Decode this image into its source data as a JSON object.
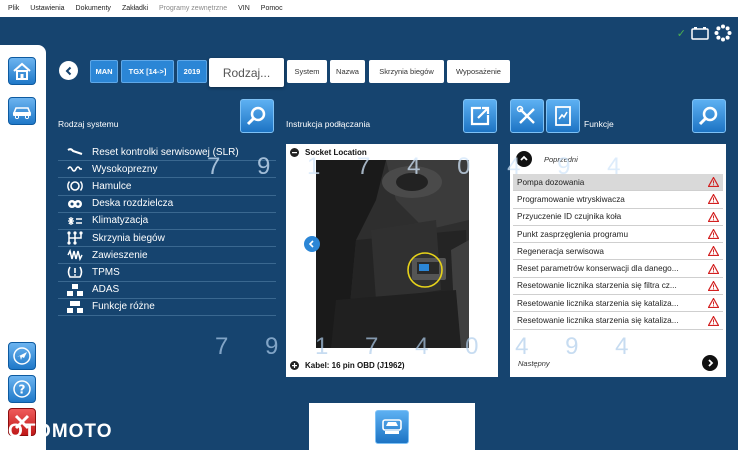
{
  "menu": [
    "Plik",
    "Ustawienia",
    "Dokumenty",
    "Zakładki",
    "Programy zewnętrzne",
    "VIN",
    "Pomoc"
  ],
  "breadcrumb": {
    "make": "MAN",
    "model": "TGX [14->]",
    "year": "2019",
    "active": "Rodzaj...",
    "tabs": [
      "System",
      "Nazwa",
      "Skrzynia biegów",
      "Wyposażenie"
    ]
  },
  "systems": {
    "title": "Rodzaj systemu",
    "items": [
      {
        "label": "Reset kontrolki serwisowej (SLR)",
        "icon": "wrench-icon"
      },
      {
        "label": "Wysokoprezny",
        "icon": "glow-plug-icon"
      },
      {
        "label": "Hamulce",
        "icon": "brake-icon"
      },
      {
        "label": "Deska rozdzielcza",
        "icon": "dashboard-icon"
      },
      {
        "label": "Klimatyzacja",
        "icon": "climate-icon"
      },
      {
        "label": "Skrzynia biegów",
        "icon": "gearbox-icon"
      },
      {
        "label": "Zawieszenie",
        "icon": "suspension-icon"
      },
      {
        "label": "TPMS",
        "icon": "tpms-icon"
      },
      {
        "label": "ADAS",
        "icon": "adas-icon"
      },
      {
        "label": "Funkcje różne",
        "icon": "misc-functions-icon"
      }
    ]
  },
  "instructions": {
    "title": "Instrukcja podłączania",
    "socket_label": "Socket Location",
    "cable_label": "Kabel: 16 pin OBD (J1962)"
  },
  "functions": {
    "title": "Funkcje",
    "previous": "Poprzedni",
    "next": "Następny",
    "items": [
      {
        "label": "Pompa dozowania",
        "selected": true
      },
      {
        "label": "Programowanie wtryskiwacza",
        "selected": false
      },
      {
        "label": "Przyuczenie ID czujnika koła",
        "selected": false
      },
      {
        "label": "Punkt zasprzęglenia programu",
        "selected": false
      },
      {
        "label": "Regeneracja serwisowa",
        "selected": false
      },
      {
        "label": "Reset parametrów konserwacji dla danego...",
        "selected": false
      },
      {
        "label": "Resetowanie licznika starzenia się filtra cz...",
        "selected": false
      },
      {
        "label": "Resetowanie licznika starzenia się kataliza...",
        "selected": false
      },
      {
        "label": "Resetowanie licznika starzenia się kataliza...",
        "selected": false
      }
    ]
  },
  "watermark": {
    "top": "7 9 1 7 4 0 4 9 4",
    "bottom": "7 9 1 7 4 0 4 9 4"
  },
  "brand": "OTOMOTO",
  "colors": {
    "background": "#16446f",
    "accent": "#2b86d6",
    "warning": "#d32020",
    "ok": "#4caf50"
  }
}
